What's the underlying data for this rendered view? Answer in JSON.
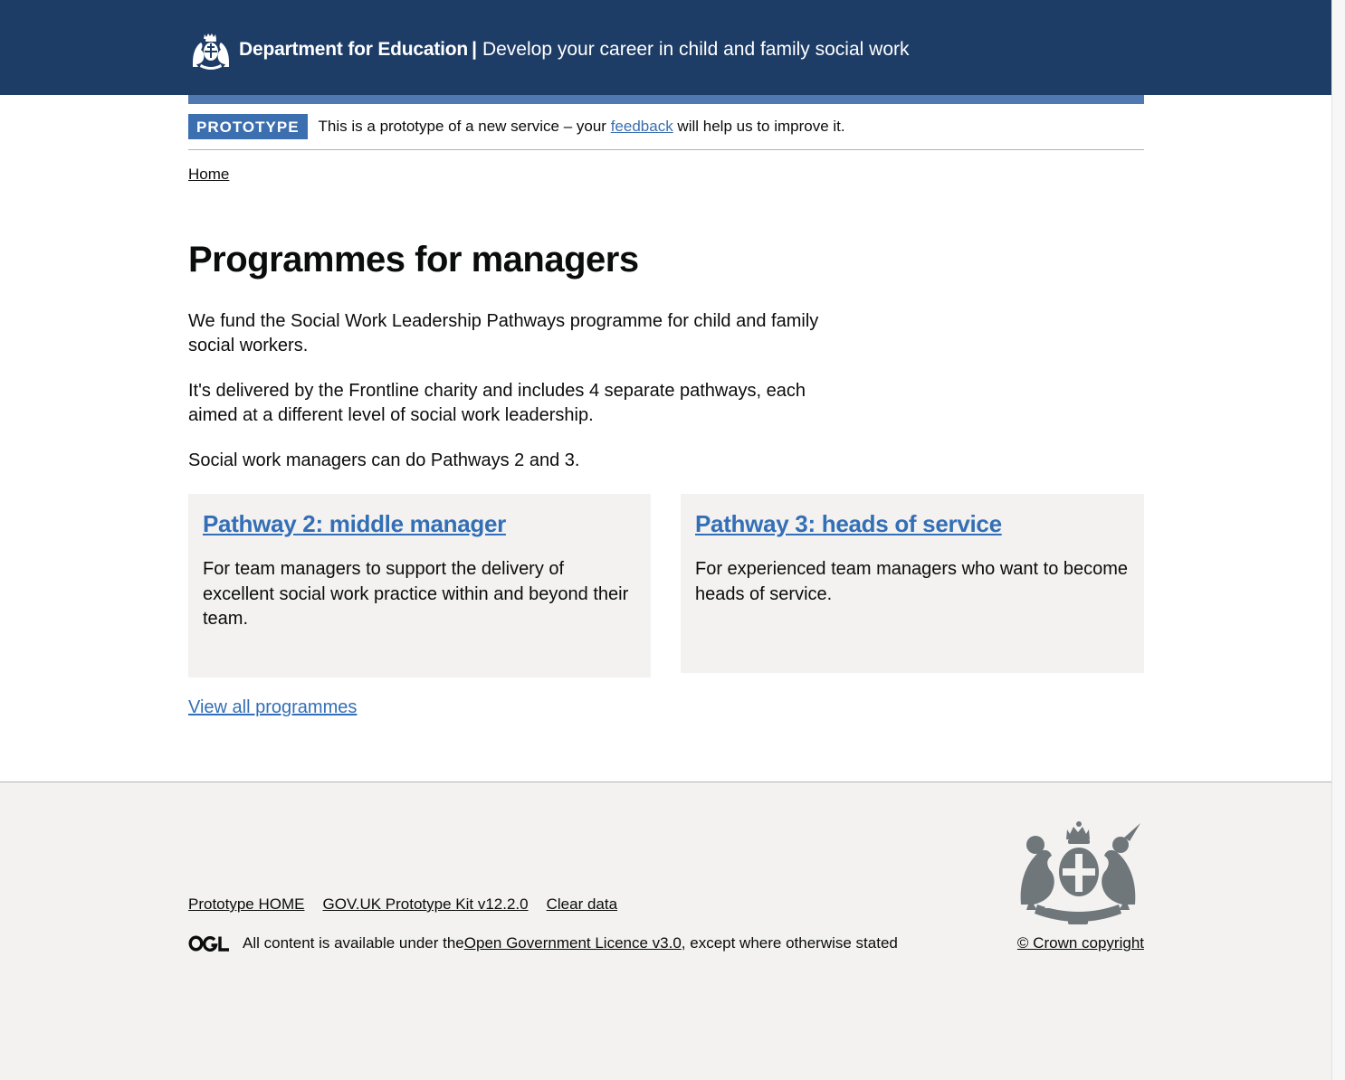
{
  "header": {
    "organisation": "Department for Education",
    "separator": "|",
    "service_name": "Develop your career in child and family social work",
    "crest_icon": "royal-crest-icon"
  },
  "phase_banner": {
    "tag": "PROTOTYPE",
    "text_before": "This is a prototype of a new service – your ",
    "link_text": "feedback",
    "text_after": " will help us to improve it."
  },
  "breadcrumb": {
    "items": [
      "Home"
    ]
  },
  "main": {
    "title": "Programmes for managers",
    "paragraphs": [
      "We fund the Social Work Leadership Pathways programme for child and family social workers.",
      "It's delivered by the Frontline charity and includes 4 separate pathways, each aimed at a different level of social work leadership.",
      "Social work managers can do Pathways 2 and 3."
    ],
    "cards": [
      {
        "title": "Pathway 2: middle manager",
        "description": "For team managers to support the delivery of excellent social work practice within and beyond their team."
      },
      {
        "title": "Pathway 3: heads of service",
        "description": "For experienced team managers who want to become heads of service."
      }
    ],
    "view_all_link": "View all programmes"
  },
  "footer": {
    "links": [
      "Prototype HOME",
      "GOV.UK Prototype Kit v12.2.0",
      "Clear data"
    ],
    "ogl_logo": "OGL",
    "licence_before": "All content is available under the ",
    "licence_link": "Open Government Licence v3.0",
    "licence_after": ", except where otherwise stated",
    "copyright": "© Crown copyright",
    "royal_arms_icon": "royal-coat-of-arms-icon"
  },
  "colors": {
    "header_bg": "#1d3c66",
    "header_bar": "#4f79b0",
    "phase_tag": "#3b6fb0",
    "link": "#336fb6",
    "card_bg": "#f3f2f1",
    "footer_bg": "#f3f2f1",
    "text": "#0b0c0c"
  }
}
